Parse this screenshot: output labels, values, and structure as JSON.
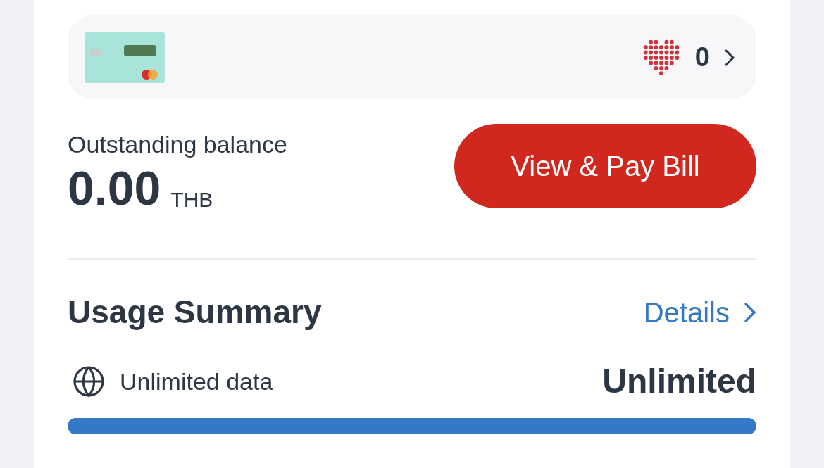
{
  "card_tile": {
    "points": "0"
  },
  "balance": {
    "label": "Outstanding balance",
    "amount": "0.00",
    "currency": "THB",
    "button": "View & Pay Bill"
  },
  "usage": {
    "title": "Usage Summary",
    "link": "Details",
    "items": [
      {
        "name": "Unlimited data",
        "value": "Unlimited",
        "level": 1
      }
    ]
  }
}
